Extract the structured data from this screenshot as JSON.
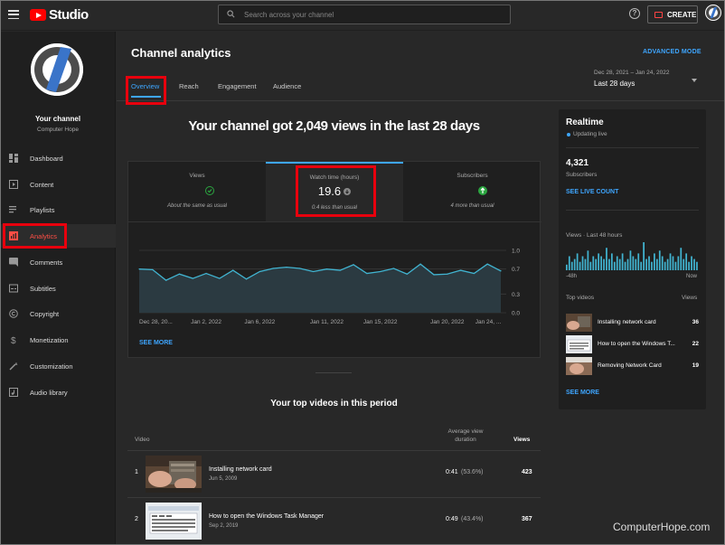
{
  "app": {
    "title": "Studio",
    "search_placeholder": "Search across your channel",
    "create_label": "CREATE"
  },
  "sidebar": {
    "channel_name": "Your channel",
    "channel_sub": "Computer Hope",
    "items": [
      {
        "label": "Dashboard",
        "icon": "dashboard-icon"
      },
      {
        "label": "Content",
        "icon": "content-icon"
      },
      {
        "label": "Playlists",
        "icon": "playlists-icon"
      },
      {
        "label": "Analytics",
        "icon": "analytics-icon",
        "active": true
      },
      {
        "label": "Comments",
        "icon": "comments-icon"
      },
      {
        "label": "Subtitles",
        "icon": "subtitles-icon"
      },
      {
        "label": "Copyright",
        "icon": "copyright-icon"
      },
      {
        "label": "Monetization",
        "icon": "monetization-icon"
      },
      {
        "label": "Customization",
        "icon": "customization-icon"
      },
      {
        "label": "Audio library",
        "icon": "audio-library-icon"
      }
    ]
  },
  "main": {
    "title": "Channel analytics",
    "advanced_mode": "ADVANCED MODE",
    "tabs": [
      {
        "label": "Overview",
        "active": true
      },
      {
        "label": "Reach"
      },
      {
        "label": "Engagement"
      },
      {
        "label": "Audience"
      }
    ],
    "date_range": {
      "sub": "Dec 28, 2021 – Jan 24, 2022",
      "value": "Last 28 days"
    },
    "headline": "Your channel got 2,049 views in the last 28 days",
    "metrics": [
      {
        "title": "Views",
        "sub": "About the same as usual"
      },
      {
        "title": "Watch time (hours)",
        "value": "19.6",
        "sub": "0.4 less than usual"
      },
      {
        "title": "Subscribers",
        "sub": "4 more than usual"
      }
    ],
    "see_more": "SEE MORE",
    "top_videos": {
      "title": "Your top videos in this period",
      "col_video": "Video",
      "col_avg": "Average view duration",
      "col_views": "Views",
      "rows": [
        {
          "num": "1",
          "title": "Installing network card",
          "date": "Jun 5, 2009",
          "avg": "0:41",
          "avg_pct": "(53.6%)",
          "views": "423"
        },
        {
          "num": "2",
          "title": "How to open the Windows Task Manager",
          "date": "Sep 2, 2019",
          "avg": "0:49",
          "avg_pct": "(43.4%)",
          "views": "367"
        }
      ]
    }
  },
  "chart_data": {
    "type": "area",
    "x_tick_labels": [
      "Dec 28, 20...",
      "Jan 2, 2022",
      "Jan 6, 2022",
      "Jan 11, 2022",
      "Jan 15, 2022",
      "Jan 20, 2022",
      "Jan 24, ..."
    ],
    "y_tick_labels": [
      "1.0",
      "0.7",
      "0.3",
      "0.0"
    ],
    "ylim": [
      0,
      1.0
    ],
    "values": [
      0.7,
      0.69,
      0.52,
      0.62,
      0.55,
      0.63,
      0.55,
      0.68,
      0.54,
      0.66,
      0.71,
      0.73,
      0.71,
      0.66,
      0.7,
      0.68,
      0.77,
      0.63,
      0.66,
      0.71,
      0.62,
      0.78,
      0.61,
      0.62,
      0.68,
      0.63,
      0.78,
      0.67
    ],
    "grid": true,
    "line_color": "#41b4d1"
  },
  "realtime": {
    "title": "Realtime",
    "updating": "Updating live",
    "subscribers": "4,321",
    "subscribers_label": "Subscribers",
    "see_live": "SEE LIVE COUNT",
    "views_label": "Views · Last 48 hours",
    "bars": [
      2,
      5,
      3,
      4,
      6,
      3,
      5,
      4,
      7,
      3,
      5,
      4,
      6,
      5,
      4,
      8,
      4,
      6,
      3,
      5,
      4,
      6,
      3,
      4,
      7,
      5,
      4,
      6,
      3,
      10,
      4,
      5,
      3,
      6,
      4,
      7,
      5,
      3,
      4,
      6,
      5,
      3,
      5,
      8,
      4,
      6,
      3,
      5,
      4,
      3
    ],
    "axis_left": "-48h",
    "axis_right": "Now",
    "top_videos_label": "Top videos",
    "views_col": "Views",
    "videos": [
      {
        "name": "Installing network card",
        "count": "36"
      },
      {
        "name": "How to open the Windows T...",
        "count": "22"
      },
      {
        "name": "Removing Network Card",
        "count": "19"
      }
    ],
    "see_more": "SEE MORE"
  },
  "watermark": "ComputerHope.com",
  "colors": {
    "accent": "#3ea6ff",
    "highlight": "#e8000d",
    "brand": "#ff0000"
  }
}
